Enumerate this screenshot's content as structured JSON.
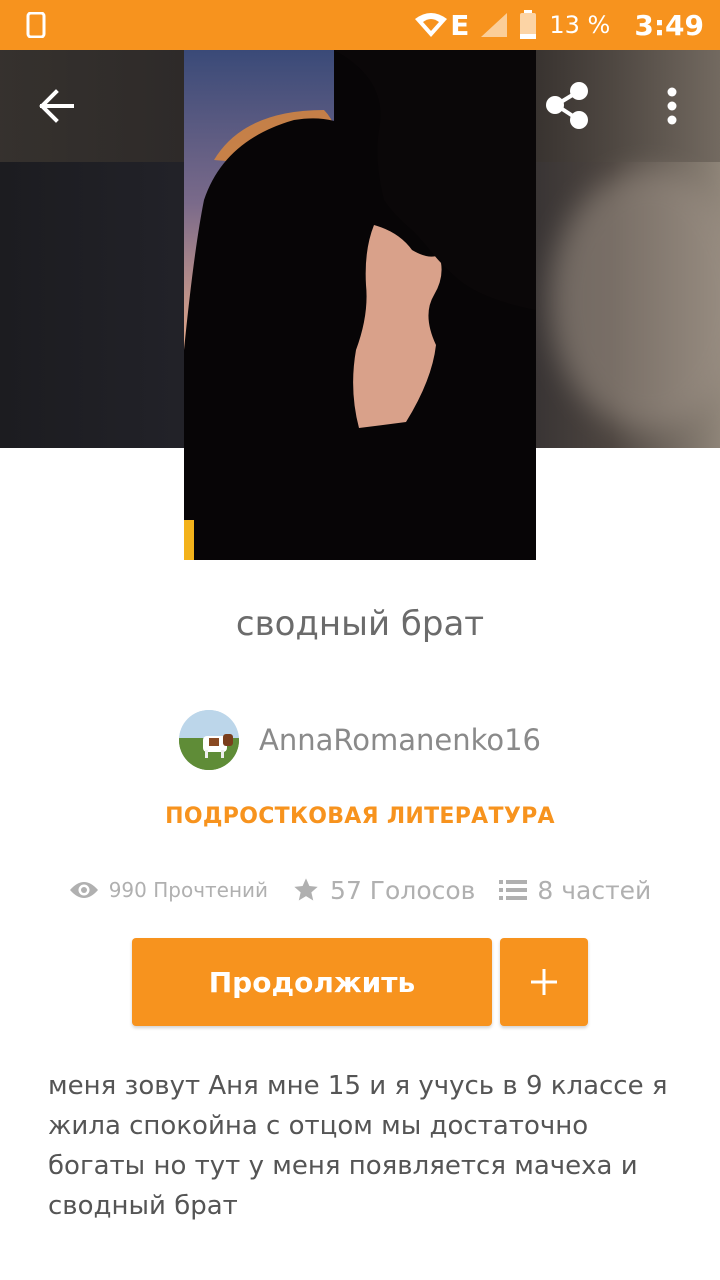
{
  "status_bar": {
    "battery_percent": "13 %",
    "time": "3:49",
    "network_label": "E",
    "icons": [
      "phone-icon",
      "wifi-icon",
      "signal-icon",
      "battery-icon"
    ]
  },
  "toolbar": {
    "back_icon": "arrow-left-icon",
    "share_icon": "share-icon",
    "more_icon": "more-vertical-icon"
  },
  "story": {
    "title": "сводный брат",
    "author": "AnnaRomanenko16",
    "genre": "ПОДРОСТКОВАЯ ЛИТЕРАТУРА",
    "stats": {
      "reads": "990 Прочтений",
      "votes": "57 Голосов",
      "parts": "8 частей"
    },
    "description": "меня зовут Аня мне 15 и я учусь в 9 классе я жила спокойна с отцом мы достаточно богаты но тут у меня появляется мачеха и сводный брат"
  },
  "actions": {
    "continue_label": "Продолжить",
    "add_icon": "plus-icon"
  },
  "colors": {
    "accent": "#f7931e",
    "text_muted": "#b0b0b0",
    "title": "#6b6b6b"
  }
}
